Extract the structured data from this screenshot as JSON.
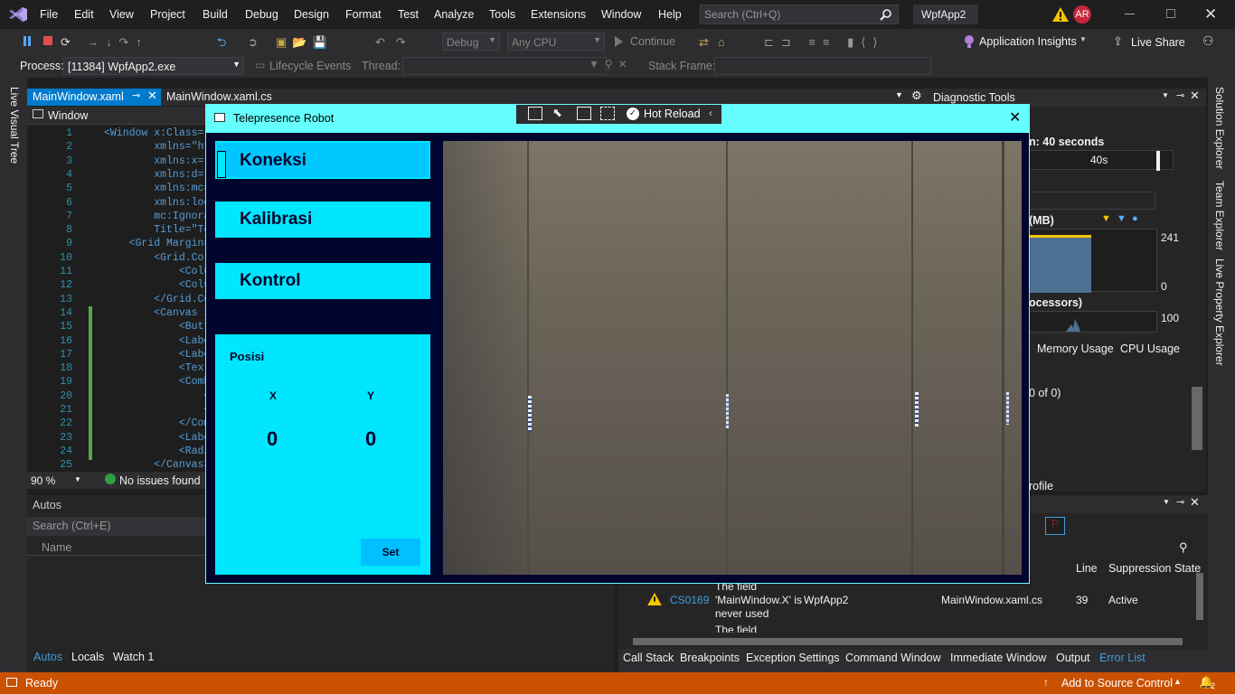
{
  "menu": {
    "items": [
      "File",
      "Edit",
      "View",
      "Project",
      "Build",
      "Debug",
      "Design",
      "Format",
      "Test",
      "Analyze",
      "Tools",
      "Extensions",
      "Window",
      "Help"
    ],
    "search_placeholder": "Search (Ctrl+Q)",
    "solution_name": "WpfApp2",
    "user_initials": "AR"
  },
  "toolbar": {
    "config": "Debug",
    "platform": "Any CPU",
    "continue": "Continue",
    "app_insights": "Application Insights",
    "live_share": "Live Share"
  },
  "debug_location": {
    "process_label": "Process:",
    "process_value": "[11384] WpfApp2.exe",
    "lifecycle": "Lifecycle Events",
    "thread_label": "Thread:",
    "stack_frame_label": "Stack Frame:"
  },
  "side_left": {
    "live_visual_tree": "Live Visual Tree"
  },
  "side_right": {
    "solution_explorer": "Solution Explorer",
    "team_explorer": "Team Explorer",
    "live_property_explorer": "Live Property Explorer"
  },
  "editor": {
    "tabs": [
      {
        "label": "MainWindow.xaml",
        "active": true
      },
      {
        "label": "MainWindow.xaml.cs",
        "active": false
      }
    ],
    "breadcrumb": "Window",
    "zoom": "90 %",
    "issues": "No issues found",
    "lines": [
      "1",
      "2",
      "3",
      "4",
      "5",
      "6",
      "7",
      "8",
      "9",
      "10",
      "11",
      "12",
      "13",
      "14",
      "15",
      "16",
      "17",
      "18",
      "19",
      "20",
      "21",
      "22",
      "23",
      "24",
      "25"
    ],
    "code": [
      "<Window x:Class=\"",
      "        xmlns=\"htt",
      "        xmlns:x=\"h",
      "        xmlns:d=\"h",
      "        xmlns:mc=\"",
      "        xmlns:loca",
      "        mc:Ignorab",
      "        Title=\"Te",
      "    <Grid Margin=\"",
      "        <Grid.Colu",
      "            <Colum",
      "            <Colum",
      "        </Grid.Col",
      "        <Canvas x",
      "            <Butto",
      "            <Label",
      "            <Label",
      "            <TextB",
      "            <Combo",
      "                <C",
      "                <C",
      "            </Comb",
      "            <Label",
      "            <Radio",
      "        </Canvas>"
    ]
  },
  "autos": {
    "title": "Autos",
    "search": "Search (Ctrl+E)",
    "column": "Name",
    "tabs": [
      "Autos",
      "Locals",
      "Watch 1"
    ]
  },
  "diagnostics": {
    "title": "Diagnostic Tools",
    "session": "n: 40 seconds",
    "time_tick": "40s",
    "memory_label": "(MB)",
    "mem_max": "241",
    "mem_min": "0",
    "cpu_label": "ocessors)",
    "cpu_max": "100",
    "tabs": [
      "Memory Usage",
      "CPU Usage"
    ],
    "event_count": "0 of 0)",
    "profile": "rofile"
  },
  "error_list": {
    "columns": [
      "Line",
      "Suppression State"
    ],
    "row_code": "CS0169",
    "row_desc_prefix": "The field",
    "row_desc": [
      "'MainWindow.X' is",
      "never used"
    ],
    "row_project": "WpfApp2",
    "row_file": "MainWindow.xaml.cs",
    "row_line": "39",
    "row_state": "Active",
    "next_desc": "The field"
  },
  "bottom_tabs": [
    "Call Stack",
    "Breakpoints",
    "Exception Settings",
    "Command Window",
    "Immediate Window",
    "Output",
    "Error List"
  ],
  "status": {
    "ready": "Ready",
    "source_control": "Add to Source Control",
    "notifications": "2"
  },
  "app": {
    "title": "Telepresence Robot",
    "hot_reload": "Hot Reload",
    "buttons": [
      "Koneksi",
      "Kalibrasi",
      "Kontrol"
    ],
    "posisi": {
      "title": "Posisi",
      "x_label": "X",
      "y_label": "Y",
      "x_value": "0",
      "y_value": "0",
      "set_label": "Set"
    }
  },
  "colors": {
    "accent": "#007acc",
    "status_bar": "#ca5100",
    "app_bg": "#00062e",
    "app_panel": "#00e6ff",
    "app_header": "#66ffff"
  }
}
